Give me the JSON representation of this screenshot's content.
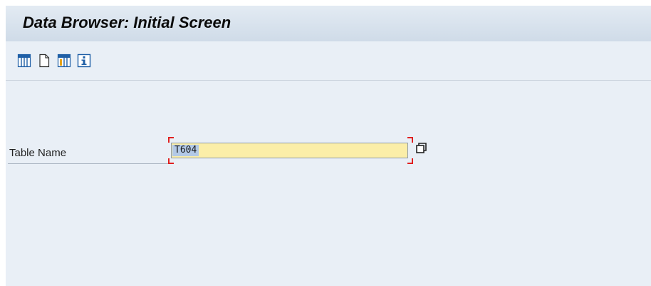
{
  "window": {
    "title": "Data Browser: Initial Screen"
  },
  "toolbar": {
    "items": [
      {
        "icon": "table-contents-icon"
      },
      {
        "icon": "create-entries-icon"
      },
      {
        "icon": "table-header-icon"
      },
      {
        "icon": "information-icon"
      }
    ]
  },
  "form": {
    "table_name_label": "Table Name",
    "table_name_value": "T604",
    "value_help_icon": "value-help-icon"
  },
  "colors": {
    "background": "#e9eff6",
    "input_required_bg": "#fbeea8",
    "required_marker": "#e02020",
    "selection": "#b3c9e6",
    "icon_blue": "#1f5fa6"
  }
}
